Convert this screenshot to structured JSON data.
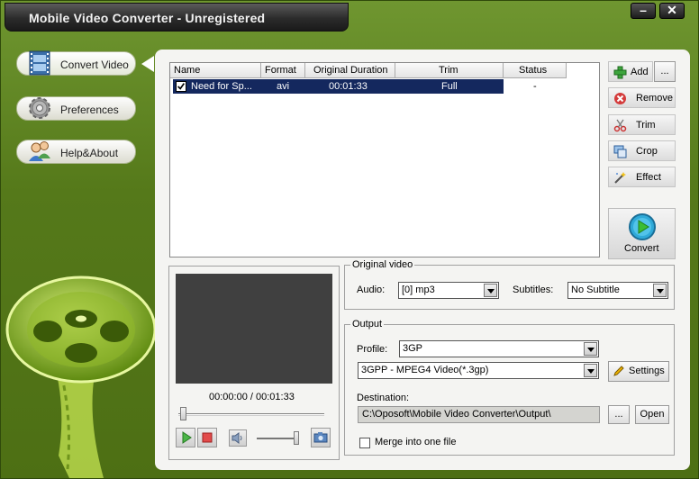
{
  "window": {
    "title": "Mobile Video Converter - Unregistered",
    "minimize_label": "–",
    "close_label": "✕"
  },
  "nav": {
    "items": [
      {
        "label": "Convert Video",
        "icon": "film-icon"
      },
      {
        "label": "Preferences",
        "icon": "gear-icon"
      },
      {
        "label": "Help&About",
        "icon": "users-icon"
      }
    ]
  },
  "file_list": {
    "columns": [
      "Name",
      "Format",
      "Original Duration",
      "Trim",
      "Status"
    ],
    "rows": [
      {
        "name": "Need for Sp...",
        "format": "avi",
        "duration": "00:01:33",
        "trim": "Full",
        "status": "-",
        "checked": true
      }
    ]
  },
  "side_buttons": {
    "add": "Add",
    "more": "...",
    "remove": "Remove",
    "trim": "Trim",
    "crop": "Crop",
    "effect": "Effect",
    "convert": "Convert"
  },
  "preview": {
    "time": "00:00:00 / 00:01:33",
    "progress": 0.0,
    "volume": 0.9
  },
  "original_video": {
    "title": "Original video",
    "audio_label": "Audio:",
    "audio_value": "[0] mp3",
    "subtitles_label": "Subtitles:",
    "subtitles_value": "No Subtitle"
  },
  "output": {
    "title": "Output",
    "profile_label": "Profile:",
    "profile_value": "3GP",
    "format_value": "3GPP - MPEG4 Video(*.3gp)",
    "settings_label": "Settings",
    "destination_label": "Destination:",
    "destination_value": "C:\\Oposoft\\Mobile Video Converter\\Output\\",
    "browse_label": "...",
    "open_label": "Open",
    "merge_label": "Merge into one file",
    "merge_checked": false
  },
  "colors": {
    "accent_green": "#5c7f1d",
    "selection": "#14285e",
    "title_bar": "#2b2b2b"
  }
}
